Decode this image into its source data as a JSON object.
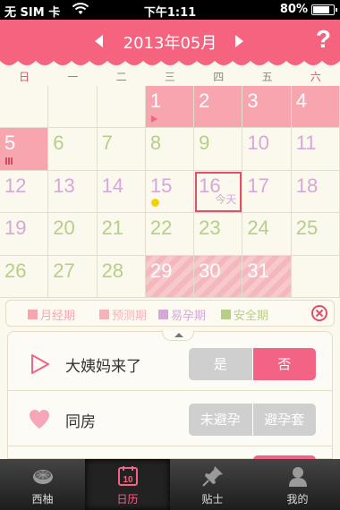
{
  "status_bar": {
    "carrier": "无 SIM 卡",
    "time": "下午1:11",
    "battery": "80%"
  },
  "header": {
    "month_title": "2013年05月",
    "help": "?"
  },
  "weekdays": [
    "日",
    "一",
    "二",
    "三",
    "四",
    "五",
    "六"
  ],
  "calendar": {
    "today_label": "今天",
    "days": [
      {
        "day": "1",
        "type": "menses",
        "mark": "play"
      },
      {
        "day": "2",
        "type": "menses"
      },
      {
        "day": "3",
        "type": "menses"
      },
      {
        "day": "4",
        "type": "menses"
      },
      {
        "day": "5",
        "type": "menses",
        "mark": "bars"
      },
      {
        "day": "6",
        "type": "safe"
      },
      {
        "day": "7",
        "type": "safe"
      },
      {
        "day": "8",
        "type": "safe"
      },
      {
        "day": "9",
        "type": "safe"
      },
      {
        "day": "10",
        "type": "fertile"
      },
      {
        "day": "11",
        "type": "fertile"
      },
      {
        "day": "12",
        "type": "fertile"
      },
      {
        "day": "13",
        "type": "fertile"
      },
      {
        "day": "14",
        "type": "fertile"
      },
      {
        "day": "15",
        "type": "fertile",
        "mark": "dot"
      },
      {
        "day": "16",
        "type": "fertile",
        "today": true
      },
      {
        "day": "17",
        "type": "fertile"
      },
      {
        "day": "18",
        "type": "fertile"
      },
      {
        "day": "19",
        "type": "fertile"
      },
      {
        "day": "20",
        "type": "safe"
      },
      {
        "day": "21",
        "type": "safe"
      },
      {
        "day": "22",
        "type": "safe"
      },
      {
        "day": "23",
        "type": "safe"
      },
      {
        "day": "24",
        "type": "safe"
      },
      {
        "day": "25",
        "type": "safe"
      },
      {
        "day": "26",
        "type": "safe"
      },
      {
        "day": "27",
        "type": "safe"
      },
      {
        "day": "28",
        "type": "safe"
      },
      {
        "day": "29",
        "type": "predict"
      },
      {
        "day": "30",
        "type": "predict"
      },
      {
        "day": "31",
        "type": "predict"
      }
    ]
  },
  "legend": [
    {
      "label": "月经期",
      "color": "#f7a6b0"
    },
    {
      "label": "预测期",
      "color": "#f5b3b9"
    },
    {
      "label": "易孕期",
      "color": "#d6a8d9"
    },
    {
      "label": "安全期",
      "color": "#b6cf86"
    }
  ],
  "panel": {
    "rows": [
      {
        "label": "大姨妈来了",
        "icon": "play-outline-icon",
        "options": [
          "是",
          "否"
        ],
        "selected": 1
      },
      {
        "label": "同房",
        "icon": "heart-icon",
        "options": [
          "未避孕",
          "避孕套"
        ],
        "selected": -1
      }
    ]
  },
  "tabbar": [
    {
      "label": "西柚",
      "icon": "grapefruit-icon"
    },
    {
      "label": "日历",
      "icon": "calendar-icon",
      "active": true
    },
    {
      "label": "贴士",
      "icon": "pin-icon"
    },
    {
      "label": "我的",
      "icon": "user-icon"
    }
  ],
  "colors": {
    "accent": "#f5637f",
    "menses": "#f7a6b0",
    "fertile": "#d6a8d9",
    "safe": "#b6cf86",
    "tabbar": "#2a2a2a"
  }
}
